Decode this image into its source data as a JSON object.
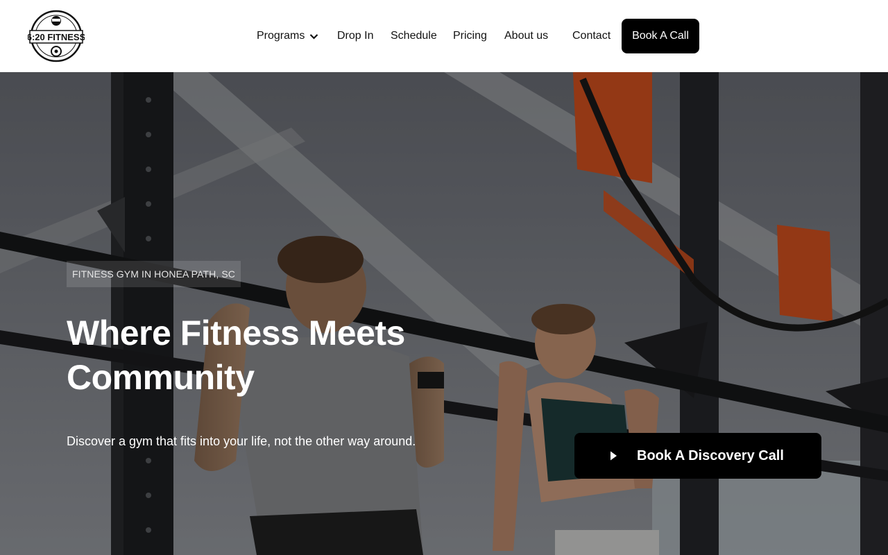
{
  "brand": {
    "logo_name": "6:20 FITNESS"
  },
  "nav": {
    "items": [
      {
        "label": "Programs",
        "has_dropdown": true
      },
      {
        "label": "Drop In"
      },
      {
        "label": "Schedule"
      },
      {
        "label": "Pricing"
      },
      {
        "label": "About us"
      },
      {
        "label": "Contact"
      }
    ],
    "cta_label": "Book A Call"
  },
  "hero": {
    "eyebrow": "FITNESS GYM IN HONEA PATH, SC",
    "headline_line1": "Where Fitness Meets",
    "headline_line2": "Community",
    "subline": "Discover a gym that fits into your life, not the other way around.",
    "cta_label": "Book A Discovery Call",
    "cta_icon": "play-icon"
  },
  "colors": {
    "button_bg": "#000000",
    "button_text": "#ffffff",
    "accent_orange": "#d9531f"
  }
}
